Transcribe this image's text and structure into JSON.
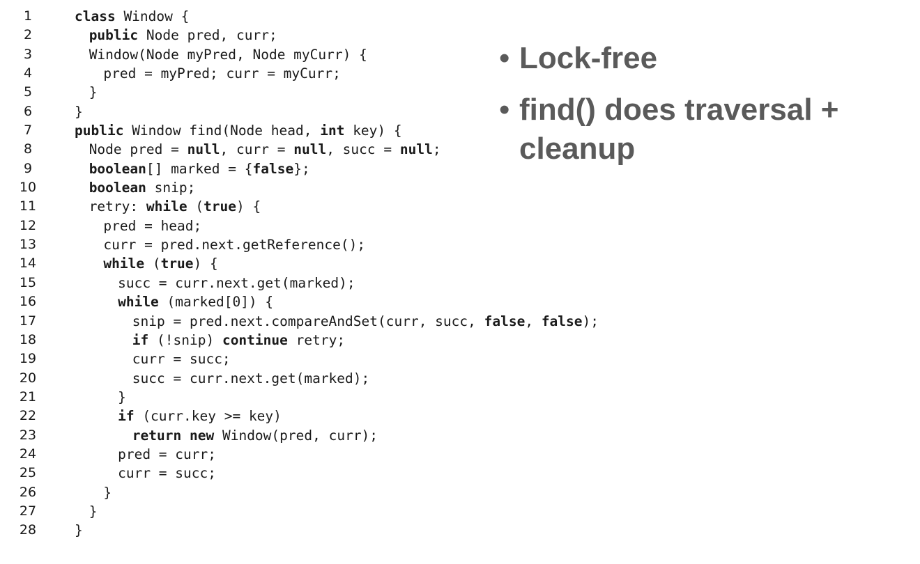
{
  "code": {
    "lines": [
      {
        "n": "1",
        "indent": 0,
        "tokens": [
          {
            "t": "class",
            "b": true
          },
          {
            "t": " Window {",
            "b": false
          }
        ]
      },
      {
        "n": "2",
        "indent": 1,
        "tokens": [
          {
            "t": "public",
            "b": true
          },
          {
            "t": " Node pred, curr;",
            "b": false
          }
        ]
      },
      {
        "n": "3",
        "indent": 1,
        "tokens": [
          {
            "t": "Window(Node myPred, Node myCurr) {",
            "b": false
          }
        ]
      },
      {
        "n": "4",
        "indent": 2,
        "tokens": [
          {
            "t": "pred = myPred; curr = myCurr;",
            "b": false
          }
        ]
      },
      {
        "n": "5",
        "indent": 1,
        "tokens": [
          {
            "t": "}",
            "b": false
          }
        ]
      },
      {
        "n": "6",
        "indent": 0,
        "tokens": [
          {
            "t": "}",
            "b": false
          }
        ]
      },
      {
        "n": "7",
        "indent": 0,
        "tokens": [
          {
            "t": "public",
            "b": true
          },
          {
            "t": " Window find(Node head, ",
            "b": false
          },
          {
            "t": "int",
            "b": true
          },
          {
            "t": " key) {",
            "b": false
          }
        ]
      },
      {
        "n": "8",
        "indent": 1,
        "tokens": [
          {
            "t": "Node pred = ",
            "b": false
          },
          {
            "t": "null",
            "b": true
          },
          {
            "t": ", curr = ",
            "b": false
          },
          {
            "t": "null",
            "b": true
          },
          {
            "t": ", succ = ",
            "b": false
          },
          {
            "t": "null",
            "b": true
          },
          {
            "t": ";",
            "b": false
          }
        ]
      },
      {
        "n": "9",
        "indent": 1,
        "tokens": [
          {
            "t": "boolean",
            "b": true
          },
          {
            "t": "[] marked = {",
            "b": false
          },
          {
            "t": "false",
            "b": true
          },
          {
            "t": "};",
            "b": false
          }
        ]
      },
      {
        "n": "10",
        "indent": 1,
        "tokens": [
          {
            "t": "boolean",
            "b": true
          },
          {
            "t": " snip;",
            "b": false
          }
        ]
      },
      {
        "n": "11",
        "indent": 1,
        "tokens": [
          {
            "t": "retry: ",
            "b": false
          },
          {
            "t": "while",
            "b": true
          },
          {
            "t": " (",
            "b": false
          },
          {
            "t": "true",
            "b": true
          },
          {
            "t": ") {",
            "b": false
          }
        ]
      },
      {
        "n": "12",
        "indent": 2,
        "tokens": [
          {
            "t": "pred = head;",
            "b": false
          }
        ]
      },
      {
        "n": "13",
        "indent": 2,
        "tokens": [
          {
            "t": "curr = pred.next.getReference();",
            "b": false
          }
        ]
      },
      {
        "n": "14",
        "indent": 2,
        "tokens": [
          {
            "t": "while",
            "b": true
          },
          {
            "t": " (",
            "b": false
          },
          {
            "t": "true",
            "b": true
          },
          {
            "t": ") {",
            "b": false
          }
        ]
      },
      {
        "n": "15",
        "indent": 3,
        "tokens": [
          {
            "t": "succ = curr.next.get(marked);",
            "b": false
          }
        ]
      },
      {
        "n": "16",
        "indent": 3,
        "tokens": [
          {
            "t": "while",
            "b": true
          },
          {
            "t": " (marked[0]) {",
            "b": false
          }
        ]
      },
      {
        "n": "17",
        "indent": 4,
        "tokens": [
          {
            "t": "snip = pred.next.compareAndSet(curr, succ, ",
            "b": false
          },
          {
            "t": "false",
            "b": true
          },
          {
            "t": ", ",
            "b": false
          },
          {
            "t": "false",
            "b": true
          },
          {
            "t": ");",
            "b": false
          }
        ]
      },
      {
        "n": "18",
        "indent": 4,
        "tokens": [
          {
            "t": "if",
            "b": true
          },
          {
            "t": " (!snip) ",
            "b": false
          },
          {
            "t": "continue",
            "b": true
          },
          {
            "t": " retry;",
            "b": false
          }
        ]
      },
      {
        "n": "19",
        "indent": 4,
        "tokens": [
          {
            "t": "curr = succ;",
            "b": false
          }
        ]
      },
      {
        "n": "20",
        "indent": 4,
        "tokens": [
          {
            "t": "succ = curr.next.get(marked);",
            "b": false
          }
        ]
      },
      {
        "n": "21",
        "indent": 3,
        "tokens": [
          {
            "t": "}",
            "b": false
          }
        ]
      },
      {
        "n": "22",
        "indent": 3,
        "tokens": [
          {
            "t": "if",
            "b": true
          },
          {
            "t": " (curr.key >= key)",
            "b": false
          }
        ]
      },
      {
        "n": "23",
        "indent": 4,
        "tokens": [
          {
            "t": "return",
            "b": true
          },
          {
            "t": " ",
            "b": false
          },
          {
            "t": "new",
            "b": true
          },
          {
            "t": " Window(pred, curr);",
            "b": false
          }
        ]
      },
      {
        "n": "24",
        "indent": 3,
        "tokens": [
          {
            "t": "pred = curr;",
            "b": false
          }
        ]
      },
      {
        "n": "25",
        "indent": 3,
        "tokens": [
          {
            "t": "curr = succ;",
            "b": false
          }
        ]
      },
      {
        "n": "26",
        "indent": 2,
        "tokens": [
          {
            "t": "}",
            "b": false
          }
        ]
      },
      {
        "n": "27",
        "indent": 1,
        "tokens": [
          {
            "t": "}",
            "b": false
          }
        ]
      },
      {
        "n": "28",
        "indent": 0,
        "tokens": [
          {
            "t": "}",
            "b": false
          }
        ]
      }
    ]
  },
  "bullets": [
    {
      "dot": "•",
      "text": "Lock-free"
    },
    {
      "dot": "•",
      "text": "find() does traversal + cleanup"
    }
  ]
}
